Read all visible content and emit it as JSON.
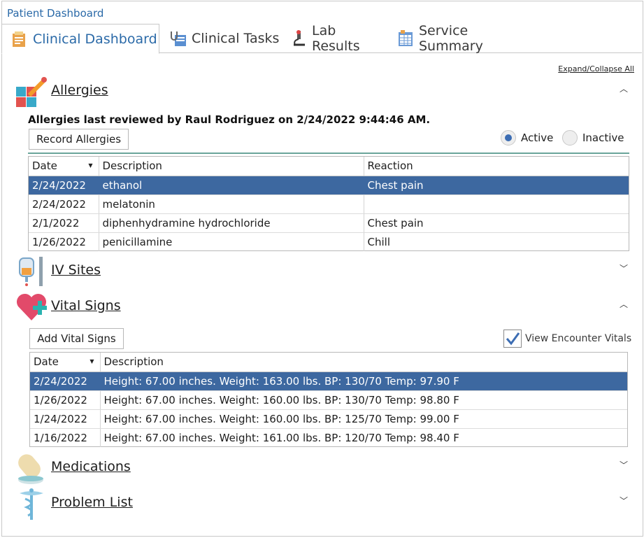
{
  "window": {
    "title": "Patient Dashboard"
  },
  "tabs": [
    {
      "label": "Clinical Dashboard",
      "icon": "clipboard-icon"
    },
    {
      "label": "Clinical Tasks",
      "icon": "stethoscope-icon"
    },
    {
      "label": "Lab Results",
      "icon": "microscope-icon"
    },
    {
      "label": "Service Summary",
      "icon": "spreadsheet-icon"
    }
  ],
  "expand_collapse_label": "Expand/Collapse All",
  "allergies": {
    "title": "Allergies",
    "note": "Allergies last reviewed by Raul Rodriguez on 2/24/2022 9:44:46 AM.",
    "record_button": "Record Allergies",
    "radio_active": "Active",
    "radio_inactive": "Inactive",
    "columns": [
      "Date",
      "Description",
      "Reaction"
    ],
    "rows": [
      {
        "date": "2/24/2022",
        "description": "ethanol",
        "reaction": "Chest pain"
      },
      {
        "date": "2/24/2022",
        "description": "melatonin",
        "reaction": ""
      },
      {
        "date": "2/1/2022",
        "description": "diphenhydramine hydrochloride",
        "reaction": "Chest pain"
      },
      {
        "date": "1/26/2022",
        "description": "penicillamine",
        "reaction": "Chill"
      }
    ]
  },
  "iv_sites": {
    "title": "IV Sites"
  },
  "vital_signs": {
    "title": "Vital Signs",
    "add_button": "Add Vital Signs",
    "view_encounter_label": "View Encounter Vitals",
    "columns": [
      "Date",
      "Description"
    ],
    "rows": [
      {
        "date": "2/24/2022",
        "description": "Height: 67.00 inches. Weight: 163.00 lbs. BP: 130/70 Temp: 97.90 F"
      },
      {
        "date": "1/26/2022",
        "description": "Height: 67.00 inches. Weight: 160.00 lbs. BP: 130/70 Temp: 98.80 F"
      },
      {
        "date": "1/24/2022",
        "description": "Height: 67.00 inches. Weight: 160.00 lbs. BP: 125/70 Temp: 99.00 F"
      },
      {
        "date": "1/16/2022",
        "description": "Height: 67.00 inches. Weight: 161.00 lbs. BP: 120/70 Temp: 98.40 F"
      }
    ]
  },
  "medications": {
    "title": "Medications"
  },
  "problem_list": {
    "title": "Problem List"
  },
  "colors": {
    "accent": "#2b6aa8",
    "selected_row": "#3d68a0",
    "divider": "#6aa59a",
    "radio_on": "#3c6db3"
  }
}
